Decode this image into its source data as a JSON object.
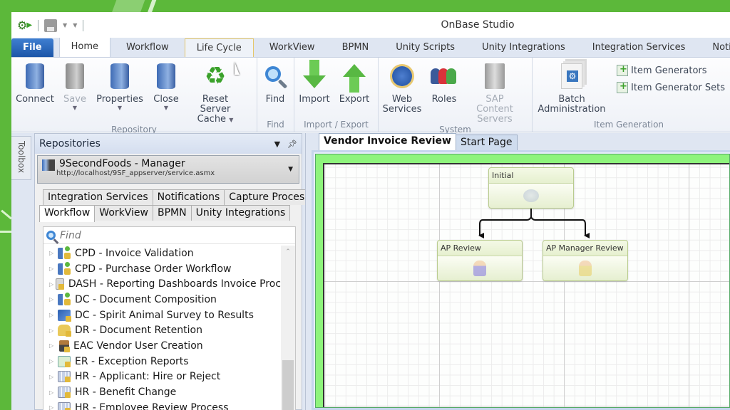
{
  "window": {
    "title": "OnBase Studio"
  },
  "quick_access": {
    "icons": [
      "studio-gear-icon",
      "save-disk-icon",
      "customize-dropdown-icon"
    ]
  },
  "ribbon_tabs": [
    {
      "label": "File"
    },
    {
      "label": "Home",
      "state": "active"
    },
    {
      "label": "Workflow"
    },
    {
      "label": "Life Cycle",
      "state": "hover"
    },
    {
      "label": "WorkView"
    },
    {
      "label": "BPMN"
    },
    {
      "label": "Unity Scripts"
    },
    {
      "label": "Unity Integrations"
    },
    {
      "label": "Integration Services"
    },
    {
      "label": "Notificatio"
    }
  ],
  "ribbon_groups": {
    "repository": {
      "label": "Repository",
      "buttons": [
        {
          "label": "Connect",
          "icon": "connect-database-icon"
        },
        {
          "label": "Save",
          "icon": "save-icon",
          "disabled": true,
          "dropdown": true
        },
        {
          "label": "Properties",
          "icon": "properties-database-icon",
          "dropdown": true
        },
        {
          "label": "Close",
          "icon": "close-database-icon",
          "dropdown": true
        },
        {
          "label_line1": "Reset Server",
          "label_line2": "Cache",
          "icon": "recycle-icon",
          "dropdown": true
        }
      ]
    },
    "find": {
      "label": "Find",
      "buttons": [
        {
          "label": "Find",
          "icon": "magnifier-icon"
        }
      ]
    },
    "import_export": {
      "label": "Import / Export",
      "buttons": [
        {
          "label": "Import",
          "icon": "import-arrow-icon"
        },
        {
          "label": "Export",
          "icon": "export-arrow-icon"
        }
      ]
    },
    "system": {
      "label": "System",
      "buttons": [
        {
          "label_line1": "Web",
          "label_line2": "Services",
          "icon": "web-services-icon"
        },
        {
          "label": "Roles",
          "icon": "roles-icon"
        },
        {
          "label_line1": "SAP Content",
          "label_line2": "Servers",
          "icon": "server-icon",
          "disabled": true
        }
      ]
    },
    "item_generation": {
      "label": "Item Generation",
      "batch": {
        "label_line1": "Batch",
        "label_line2": "Administration",
        "icon": "batch-icon"
      },
      "small_buttons": [
        {
          "label": "Item Generators",
          "icon": "item-generators-icon"
        },
        {
          "label": "Item Generator Sets",
          "icon": "item-generator-sets-icon"
        }
      ]
    }
  },
  "toolbox": {
    "label": "Toolbox"
  },
  "repositories_panel": {
    "title": "Repositories",
    "repository": {
      "name": "9SecondFoods - Manager",
      "url": "http://localhost/9SF_appserver/service.asmx"
    },
    "tabs_row1": [
      "Integration Services",
      "Notifications",
      "Capture Process"
    ],
    "tabs_row2": [
      "Workflow",
      "WorkView",
      "BPMN",
      "Unity Integrations"
    ],
    "active_tab": "Workflow",
    "find_placeholder": "Find",
    "tree_items": [
      {
        "label": "CPD - Invoice Validation",
        "icon": "wf"
      },
      {
        "label": "CPD - Purchase Order Workflow",
        "icon": "wf"
      },
      {
        "label": "DASH - Reporting Dashboards Invoice Proc",
        "icon": "dash"
      },
      {
        "label": "DC - Document Composition",
        "icon": "wf"
      },
      {
        "label": "DC - Spirit Animal Survey to Results",
        "icon": "spirit"
      },
      {
        "label": "DR - Document Retention",
        "icon": "lock"
      },
      {
        "label": "EAC Vendor User Creation",
        "icon": "stamp"
      },
      {
        "label": "ER - Exception Reports",
        "icon": "er"
      },
      {
        "label": "HR - Applicant: Hire or Reject",
        "icon": "grid"
      },
      {
        "label": "HR - Benefit Change",
        "icon": "grid"
      },
      {
        "label": "HR - Employee Review Process",
        "icon": "grid"
      }
    ]
  },
  "document_tabs": [
    {
      "label": "Vendor Invoice Review",
      "active": true
    },
    {
      "label": "Start Page"
    }
  ],
  "workflow_diagram": {
    "nodes": [
      {
        "id": "initial",
        "label": "Initial",
        "icon": "cloud"
      },
      {
        "id": "ap_review",
        "label": "AP Review",
        "icon": "user1"
      },
      {
        "id": "ap_manager_review",
        "label": "AP Manager Review",
        "icon": "user2"
      }
    ],
    "edges": [
      {
        "from": "initial",
        "to": "ap_review"
      },
      {
        "from": "initial",
        "to": "ap_manager_review"
      }
    ]
  }
}
